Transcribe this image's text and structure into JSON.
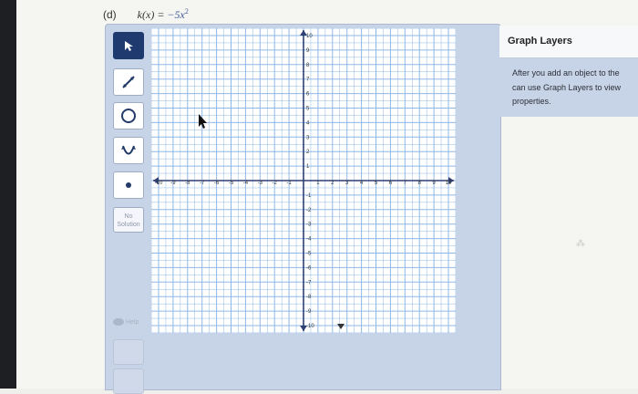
{
  "problem": {
    "label": "(d)",
    "function_lhs": "k(x) =",
    "function_rhs": "−5x",
    "exponent": "2"
  },
  "toolbar": {
    "tools": [
      {
        "name": "select-tool",
        "icon": "cursor-arrow-icon",
        "active": true
      },
      {
        "name": "line-tool",
        "icon": "line-segment-icon",
        "active": false
      },
      {
        "name": "circle-tool",
        "icon": "circle-icon",
        "active": false
      },
      {
        "name": "parabola-tool",
        "icon": "parabola-icon",
        "active": false
      },
      {
        "name": "point-tool",
        "icon": "point-icon",
        "active": false
      }
    ],
    "no_solution_line1": "No",
    "no_solution_line2": "Solution",
    "help_label": "Help"
  },
  "graph": {
    "x_min": -10,
    "x_max": 10,
    "y_min": -10,
    "y_max": 10,
    "minor_step": 0.5,
    "major_step": 1,
    "x_ticks": [
      "-10",
      "-9",
      "-8",
      "-7",
      "-6",
      "-5",
      "-4",
      "-3",
      "-2",
      "-1",
      "1",
      "2",
      "3",
      "4",
      "5",
      "6",
      "7",
      "8",
      "9",
      "10"
    ],
    "y_ticks": [
      "10",
      "9",
      "8",
      "7",
      "6",
      "5",
      "4",
      "3",
      "2",
      "1",
      "-1",
      "-2",
      "-3",
      "-4",
      "-5",
      "-6",
      "-7",
      "-8",
      "-9",
      "-10"
    ],
    "grid_color": "#8fb8e6",
    "axis_color": "#2f3f73"
  },
  "layers": {
    "title": "Graph Layers",
    "line1": "After you add an object to the",
    "line2": "can use Graph Layers to view",
    "line3": "properties."
  }
}
